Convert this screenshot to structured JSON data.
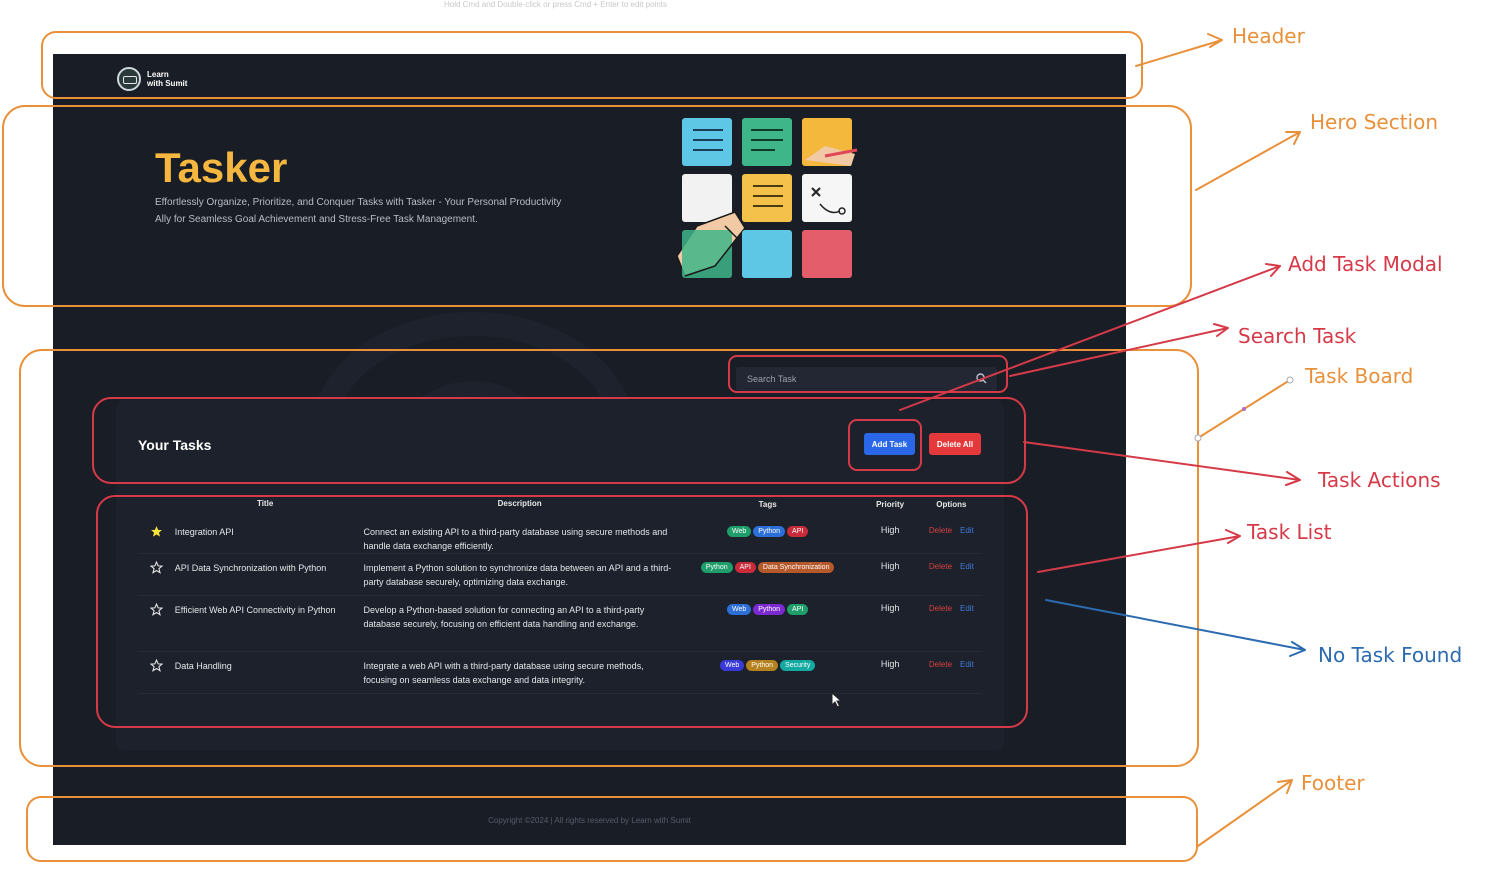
{
  "editor_hint": "Hold Cmd and Double-click or press Cmd + Enter to edit points",
  "header": {
    "logo_line1": "Learn",
    "logo_line2": "with Sumit"
  },
  "hero": {
    "title": "Tasker",
    "description": "Effortlessly Organize, Prioritize, and Conquer Tasks with Tasker - Your Personal Productivity Ally for Seamless Goal Achievement and Stress-Free Task Management."
  },
  "search": {
    "placeholder": "Search Task",
    "value": ""
  },
  "board": {
    "title": "Your Tasks",
    "add_label": "Add Task",
    "delete_all_label": "Delete All",
    "columns": [
      "Title",
      "Description",
      "Tags",
      "Priority",
      "Options"
    ],
    "tasks": [
      {
        "favorite": true,
        "title": "Integration API",
        "description": "Connect an existing API to a third-party database using secure methods and handle data exchange efficiently.",
        "tags": [
          "Web",
          "Python",
          "API"
        ],
        "priority": "High",
        "delete": "Delete",
        "edit": "Edit"
      },
      {
        "favorite": false,
        "title": "API Data Synchronization with Python",
        "description": "Implement a Python solution to synchronize data between an API and a third-party database securely, optimizing data exchange.",
        "tags": [
          "Python",
          "API",
          "Data Synchronization"
        ],
        "priority": "High",
        "delete": "Delete",
        "edit": "Edit"
      },
      {
        "favorite": false,
        "title": "Efficient Web API Connectivity in Python",
        "description": "Develop a Python-based solution for connecting an API to a third-party database securely, focusing on efficient data handling and exchange.",
        "tags": [
          "Web",
          "Python",
          "API"
        ],
        "priority": "High",
        "delete": "Delete",
        "edit": "Edit"
      },
      {
        "favorite": false,
        "title": "Data Handling",
        "description": "Integrate a web API with a third-party database using secure methods, focusing on seamless data exchange and data integrity.",
        "tags": [
          "Web",
          "Python",
          "Security"
        ],
        "priority": "High",
        "delete": "Delete",
        "edit": "Edit"
      }
    ]
  },
  "footer": {
    "text": "Copyright ©2024 | All rights reserved by Learn with Sumit"
  },
  "annotations": {
    "header": "Header",
    "hero": "Hero Section",
    "add_task_modal": "Add Task Modal",
    "search_task": "Search Task",
    "task_board": "Task Board",
    "task_actions": "Task Actions",
    "task_list": "Task List",
    "no_task_found": "No Task Found",
    "footer": "Footer"
  },
  "colors": {
    "app_bg": "#191d26",
    "hero_title": "#f5b740",
    "add_button": "#2a67e8",
    "delete_button": "#e4383b",
    "orange_annotation": "#e8913a",
    "red_annotation": "#d63a48",
    "blue_annotation": "#2c6bb0",
    "tag_web": "#1f9d6a",
    "tag_python": "#2c6fd8",
    "tag_api": "#c92b3a",
    "tag_data_sync": "#b5582a",
    "tag_security": "#12a9a0"
  },
  "icons": [
    "logo-mark",
    "search-icon",
    "star-filled-icon",
    "star-outline-icon",
    "mouse-cursor-icon",
    "arrow-icon"
  ]
}
